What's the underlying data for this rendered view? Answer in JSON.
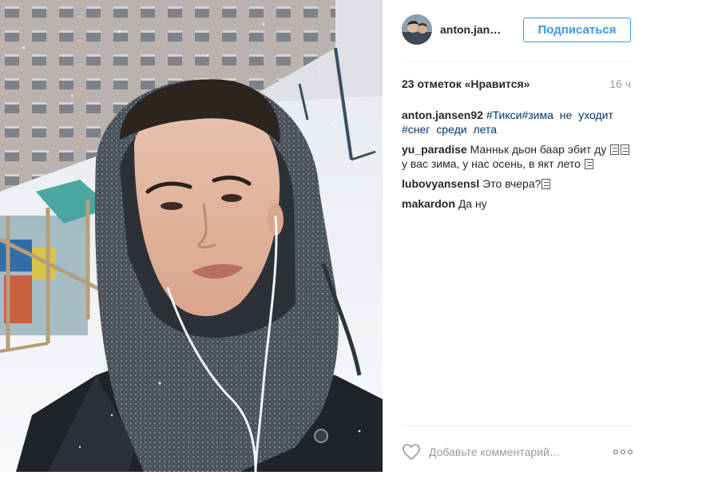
{
  "post": {
    "author": "anton.jan…",
    "follow_label": "Подписаться",
    "likes_text": "23 отметок «Нравится»",
    "time": "16 ч",
    "caption": {
      "author": "anton.jansen92",
      "tags": "#Тикси#зима не уходит #снег среди лета"
    },
    "comments": [
      {
        "author": "yu_paradise",
        "text_before": "Манньк дьон баар эбит ду",
        "text_after": "у вас зима, у нас осень, в якт лето"
      },
      {
        "author": "lubovyansensl",
        "text": "Это вчера?"
      },
      {
        "author": "makardon",
        "text": "Да ну"
      }
    ],
    "comment_placeholder": "Добавьте комментарий…"
  },
  "icons": {
    "avatar": "avatar-image",
    "like": "heart-icon",
    "more": "more-dots-icon",
    "emoji": "emoji-glyph-icon"
  },
  "colors": {
    "accent": "#3897f0",
    "hashtag": "#003569",
    "muted": "#999999",
    "text": "#262626",
    "divider": "#efefef"
  }
}
